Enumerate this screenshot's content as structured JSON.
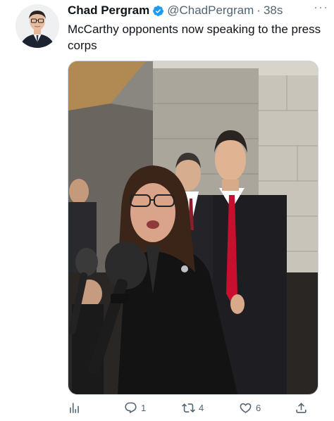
{
  "tweet": {
    "author_name": "Chad Pergram",
    "handle": "@ChadPergram",
    "separator": "·",
    "time": "38s",
    "more": "···",
    "text": "McCarthy opponents now speaking to the press corps"
  },
  "actions": {
    "replies": "1",
    "retweets": "4",
    "likes": "6"
  },
  "icons": {
    "verified": "verified-badge-icon",
    "analytics": "bar-chart-icon",
    "reply": "reply-icon",
    "retweet": "retweet-icon",
    "like": "heart-icon",
    "share": "share-icon"
  },
  "colors": {
    "verified": "#1d9bf0",
    "secondary_text": "#536471",
    "primary_text": "#0f1419"
  }
}
